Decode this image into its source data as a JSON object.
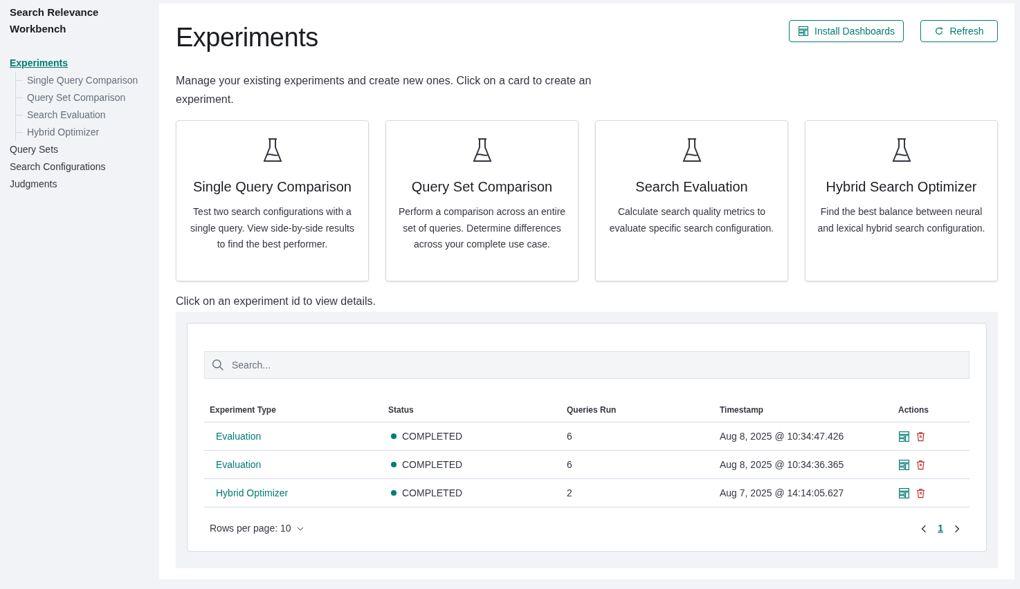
{
  "sidebar": {
    "title": "Search Relevance Workbench",
    "items": [
      {
        "label": "Experiments",
        "selected": true,
        "children": [
          {
            "label": "Single Query Comparison",
            "selected": false
          },
          {
            "label": "Query Set Comparison",
            "selected": false
          },
          {
            "label": "Search Evaluation",
            "selected": false
          },
          {
            "label": "Hybrid Optimizer",
            "selected": false
          }
        ]
      },
      {
        "label": "Query Sets",
        "selected": false
      },
      {
        "label": "Search Configurations",
        "selected": false
      },
      {
        "label": "Judgments",
        "selected": false
      }
    ]
  },
  "page": {
    "title": "Experiments",
    "buttons": [
      {
        "kind": "dashboards",
        "label": "Install Dashboards"
      },
      {
        "kind": "refresh",
        "label": "Refresh"
      }
    ],
    "description": "Manage your existing experiments and create new ones. Click on a card to create an experiment."
  },
  "cards": [
    {
      "title": "Single Query Comparison",
      "description": "Test two search configurations with a single query. View side-by-side results to find the best performer."
    },
    {
      "title": "Query Set Comparison",
      "description": "Perform a comparison across an entire set of queries. Determine differences across your complete use case."
    },
    {
      "title": "Search Evaluation",
      "description": "Calculate search quality metrics to evaluate specific search configuration."
    },
    {
      "title": "Hybrid Search Optimizer",
      "description": "Find the best balance between neural and lexical hybrid search configuration."
    }
  ],
  "table_hint": "Click on an experiment id to view details.",
  "search": {
    "placeholder": "Search..."
  },
  "table": {
    "columns": [
      "Experiment Type",
      "Status",
      "Queries Run",
      "Timestamp",
      "Actions"
    ],
    "rows": [
      {
        "type": "Evaluation",
        "status": "COMPLETED",
        "color": "#017d73",
        "queries": "6",
        "timestamp": "Aug 8, 2025 @ 10:34:47.426"
      },
      {
        "type": "Evaluation",
        "status": "COMPLETED",
        "color": "#017d73",
        "queries": "6",
        "timestamp": "Aug 8, 2025 @ 10:34:36.365"
      },
      {
        "type": "Hybrid Optimizer",
        "status": "COMPLETED",
        "color": "#017d73",
        "queries": "2",
        "timestamp": "Aug 7, 2025 @ 14:14:05.627"
      }
    ]
  },
  "pagination": {
    "rows_per_page": "Rows per page: 10",
    "pages": [
      {
        "label": "1",
        "selected": true
      }
    ]
  }
}
